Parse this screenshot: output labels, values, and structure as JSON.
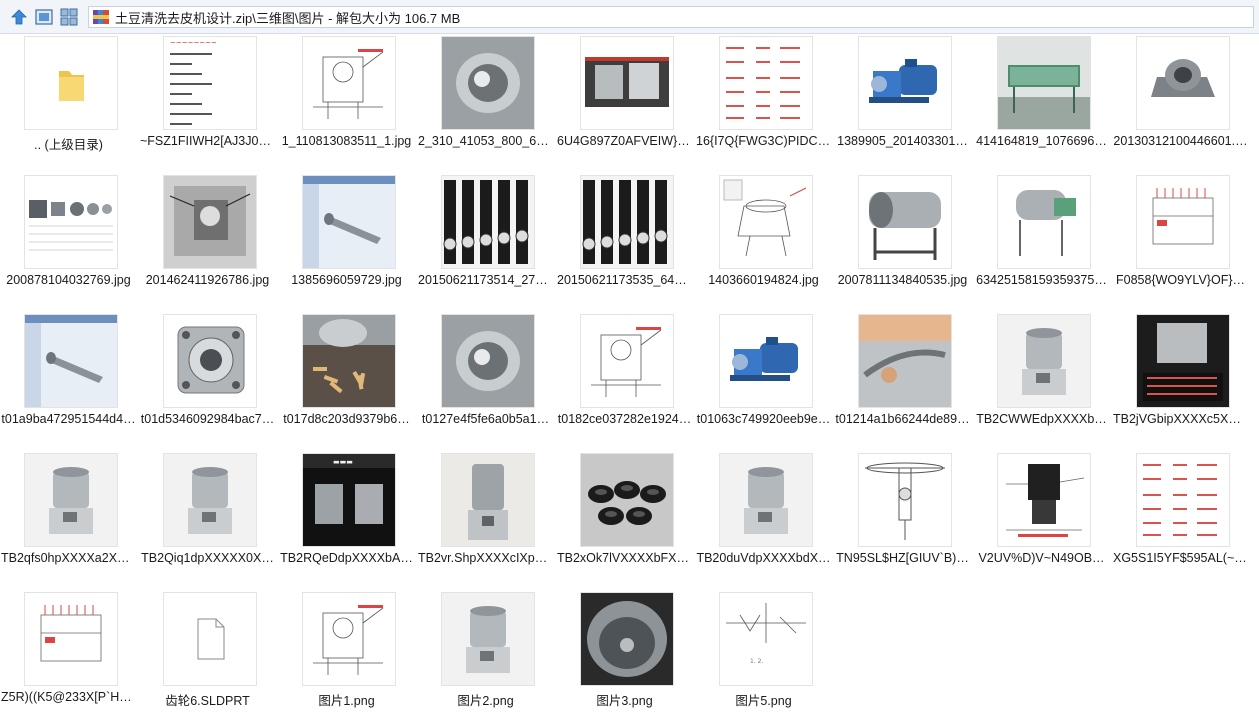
{
  "address_bar": {
    "path": "土豆清洗去皮机设计.zip\\三维图\\图片 - 解包大小为 106.7 MB",
    "icons": [
      "up-arrow-icon",
      "view-large-icon",
      "view-grid-icon",
      "zip-archive-icon"
    ]
  },
  "files": [
    {
      "name": ".. (上级目录)",
      "kind": "parent-folder"
    },
    {
      "name": "~FSZ1FIIWH2[AJ3J0(…",
      "kind": "spec-sheet"
    },
    {
      "name": "1_110813083511_1.jpg",
      "kind": "line-drawing"
    },
    {
      "name": "2_310_41053_800_60…",
      "kind": "steel-drum"
    },
    {
      "name": "6U4G897Z0AFVEIW}}…",
      "kind": "photo-machines"
    },
    {
      "name": "16{I7Q{FWG3C)PIDC`…",
      "kind": "red-table"
    },
    {
      "name": "1389905_201403301…",
      "kind": "blue-motor"
    },
    {
      "name": "414164819_1076696…",
      "kind": "green-machine"
    },
    {
      "name": "20130312100446601.…",
      "kind": "bearing-block"
    },
    {
      "name": "200878104032769.jpg",
      "kind": "parts"
    },
    {
      "name": "201462411926786.jpg",
      "kind": "bw-photo"
    },
    {
      "name": "1385696059729.jpg",
      "kind": "cad-shaft"
    },
    {
      "name": "20150621173514_271…",
      "kind": "brush-rollers"
    },
    {
      "name": "20150621173535_646…",
      "kind": "brush-rollers"
    },
    {
      "name": "1403660194824.jpg",
      "kind": "sketch-drawing"
    },
    {
      "name": "2007811134840535.jpg",
      "kind": "steel-machine"
    },
    {
      "name": "63425158159359375…",
      "kind": "steel-machine-green"
    },
    {
      "name": "F0858{WO9YLV}OF}…",
      "kind": "drawing-red"
    },
    {
      "name": "t01a9ba472951544d4…",
      "kind": "cad-shaft"
    },
    {
      "name": "t01d5346092984bac7…",
      "kind": "flange"
    },
    {
      "name": "t017d8c203d9379b6…",
      "kind": "fries-machine"
    },
    {
      "name": "t0127e4f5fe6a0b5a1…",
      "kind": "steel-drum"
    },
    {
      "name": "t0182ce037282e1924…",
      "kind": "line-drawing"
    },
    {
      "name": "t01063c749920eeb9e…",
      "kind": "blue-motor"
    },
    {
      "name": "t01214a1b66244de89…",
      "kind": "hand-photo"
    },
    {
      "name": "TB2CWWEdpXXXXb…",
      "kind": "peeler-photo"
    },
    {
      "name": "TB2jVGbipXXXXc5XX…",
      "kind": "peeler-table"
    },
    {
      "name": "TB2qfs0hpXXXXa2Xp…",
      "kind": "peeler-photo"
    },
    {
      "name": "TB2Qiq1dpXXXXX0X…",
      "kind": "peeler-photo"
    },
    {
      "name": "TB2RQeDdpXXXXbA…",
      "kind": "dark-banner"
    },
    {
      "name": "TB2vr.ShpXXXXcIXpX…",
      "kind": "peeler-tall"
    },
    {
      "name": "TB2xOk7lVXXXXbFXX…",
      "kind": "black-wheels"
    },
    {
      "name": "TB20duVdpXXXXbdX…",
      "kind": "peeler-photo"
    },
    {
      "name": "TN95SL$HZ[GIUV`B)…",
      "kind": "rotor-drawing"
    },
    {
      "name": "V2UV%D)V~N49OB…",
      "kind": "cad-unit"
    },
    {
      "name": "XG5S1I5YF$595AL(~I…",
      "kind": "red-table"
    },
    {
      "name": "Z5R)((K5@233X[P`HL(…",
      "kind": "drawing-red"
    },
    {
      "name": "齿轮6.SLDPRT",
      "kind": "blank-file"
    },
    {
      "name": "图片1.png",
      "kind": "line-drawing"
    },
    {
      "name": "图片2.png",
      "kind": "peeler-photo"
    },
    {
      "name": "图片3.png",
      "kind": "drum-top"
    },
    {
      "name": "图片5.png",
      "kind": "sketch-small"
    }
  ]
}
